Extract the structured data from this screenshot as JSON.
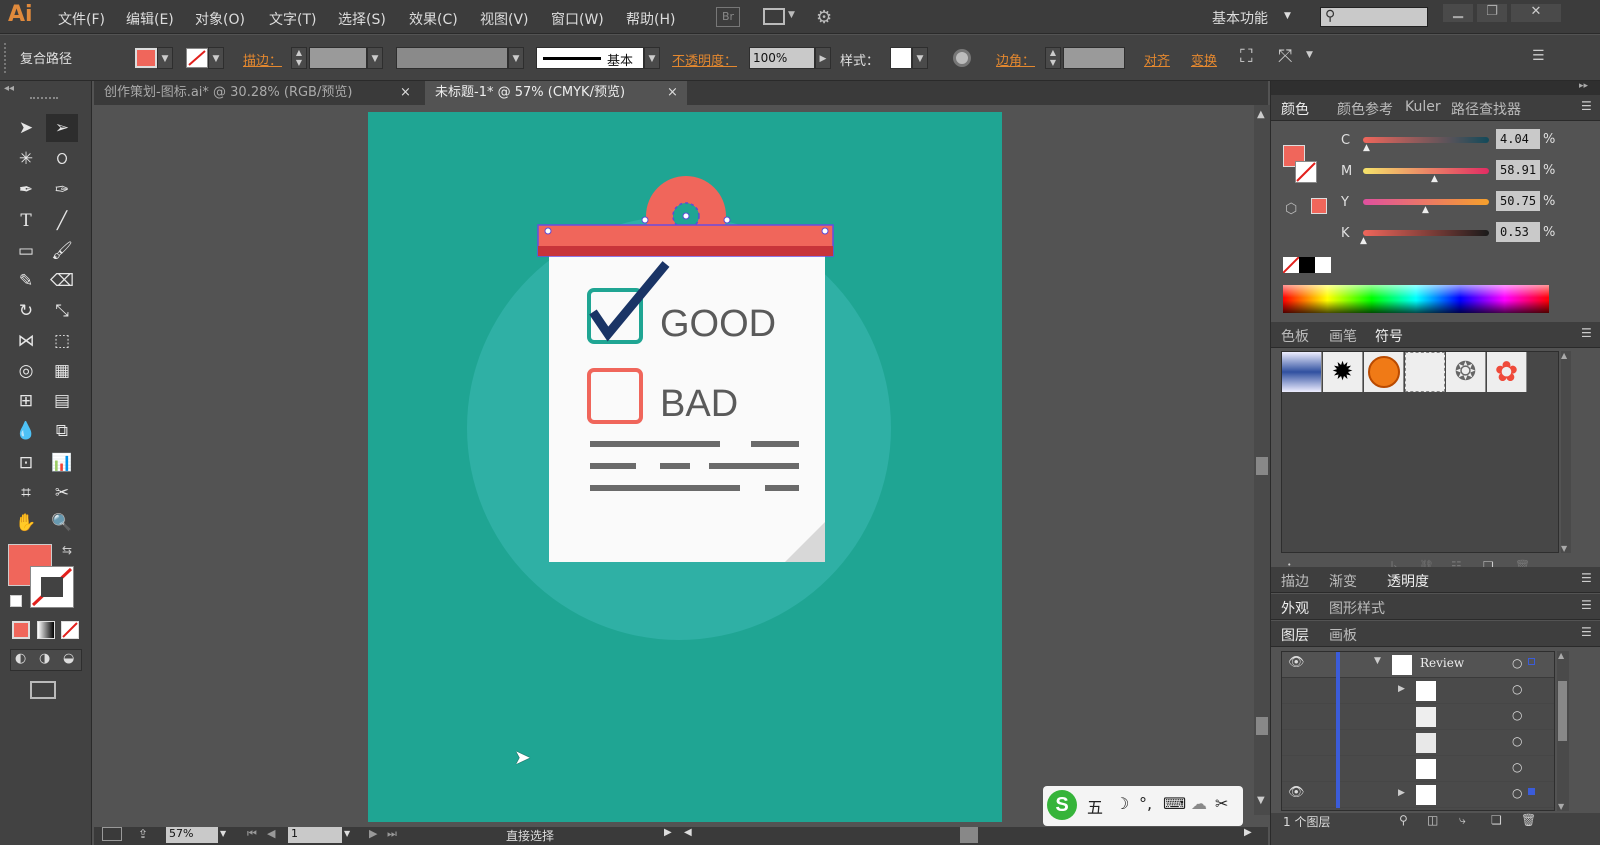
{
  "app": {
    "logo": "Ai",
    "menus": [
      "文件(F)",
      "编辑(E)",
      "对象(O)",
      "文字(T)",
      "选择(S)",
      "效果(C)",
      "视图(V)",
      "窗口(W)",
      "帮助(H)"
    ],
    "br": "Br",
    "workspace": "基本功能",
    "search_placeholder": ""
  },
  "control": {
    "path_type": "复合路径",
    "stroke_label": "描边：",
    "stroke_style": "基本",
    "opacity_label": "不透明度：",
    "opacity_value": "100%",
    "style_label": "样式：",
    "corner_label": "边角：",
    "align_label": "对齐",
    "transform_label": "变换"
  },
  "tabs": [
    {
      "label": "创作策划-图标.ai* @ 30.28% (RGB/预览)",
      "close": "×"
    },
    {
      "label": "未标题-1* @ 57% (CMYK/预览)",
      "close": "×"
    }
  ],
  "artwork": {
    "good": "GOOD",
    "bad": "BAD"
  },
  "status": {
    "zoom": "57%",
    "page": "1",
    "tool_name": "直接选择"
  },
  "color_panel": {
    "tabs": [
      "颜色",
      "颜色参考",
      "Kuler",
      "路径查找器"
    ],
    "channels": [
      {
        "name": "C",
        "value": "4.04",
        "unit": "%"
      },
      {
        "name": "M",
        "value": "58.91",
        "unit": "%"
      },
      {
        "name": "Y",
        "value": "50.75",
        "unit": "%"
      },
      {
        "name": "K",
        "value": "0.53",
        "unit": "%"
      }
    ]
  },
  "swatch_panel": {
    "tabs": [
      "色板",
      "画笔",
      "符号"
    ]
  },
  "appearance_panel": {
    "tabs": [
      "描边",
      "渐变",
      "透明度"
    ]
  },
  "style_panel": {
    "tabs": [
      "外观",
      "图形样式"
    ]
  },
  "layers_panel": {
    "tabs": [
      "图层",
      "画板"
    ],
    "layer_name": "Review",
    "layer_count": "1 个图层"
  },
  "colors": {
    "fill": "#f0665b",
    "teal": "#1fa593",
    "accent": "#e4882f"
  }
}
